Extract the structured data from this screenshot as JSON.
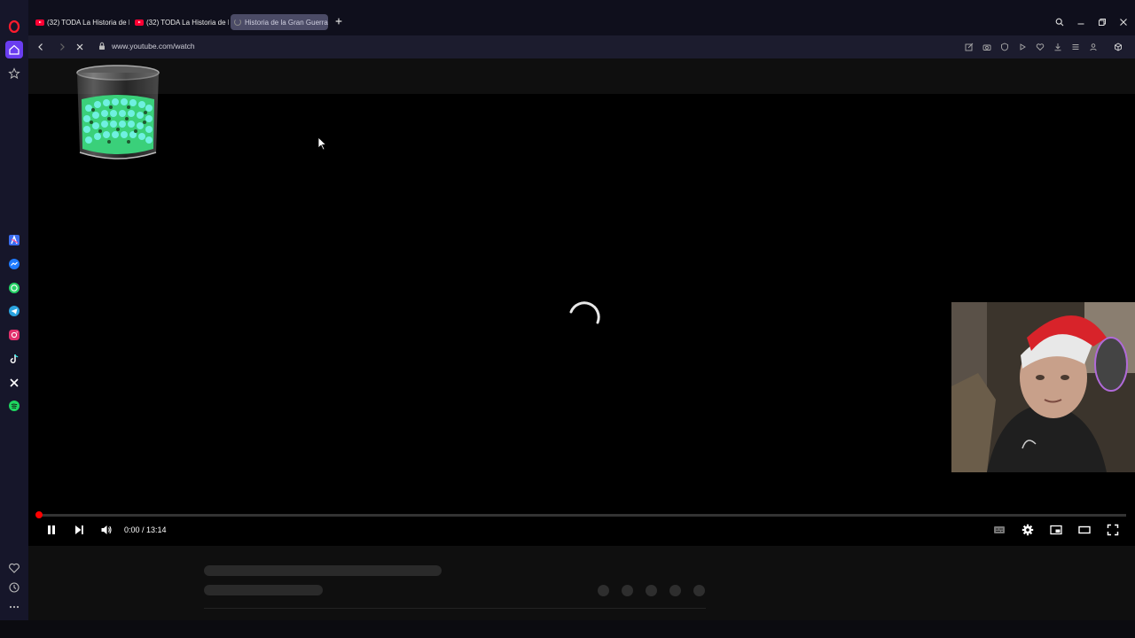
{
  "browser": {
    "tabs": [
      {
        "title": "(32) TODA La Historia de I",
        "active": false,
        "favicon": "youtube-icon"
      },
      {
        "title": "(32) TODA La Historia de I",
        "active": false,
        "favicon": "youtube-icon"
      },
      {
        "title": "Historia de la Gran Guerra",
        "active": true,
        "favicon": "loading-spinner-icon"
      }
    ],
    "url": "www.youtube.com/watch"
  },
  "sidebar": {
    "top_icons": [
      "opera-logo-icon",
      "home-icon",
      "star-icon"
    ],
    "apps": [
      "aria-icon",
      "messenger-icon",
      "whatsapp-icon",
      "telegram-icon",
      "instagram-icon",
      "tiktok-icon",
      "x-icon",
      "spotify-icon"
    ],
    "bottom_icons": [
      "heart-icon",
      "history-icon",
      "more-icon"
    ]
  },
  "player": {
    "time": "0:00 / 13:14",
    "progress": 0.0,
    "state": "loading"
  },
  "colors": {
    "accent": "#ff0000",
    "sidebar_bg": "#16162a"
  }
}
